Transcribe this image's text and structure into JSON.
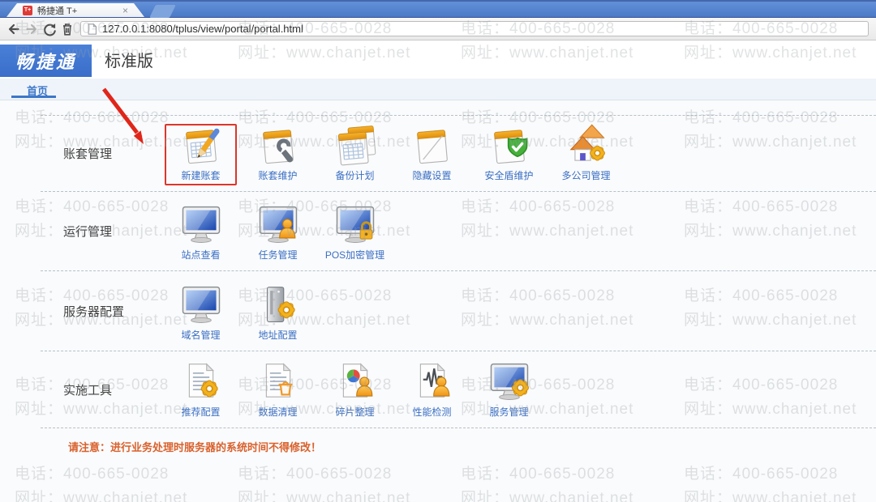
{
  "browser": {
    "tab": {
      "title": "畅捷通 T+",
      "favicon_text": "T+",
      "close_glyph": "×"
    },
    "url": "127.0.0.1:8080/tplus/view/portal/portal.html"
  },
  "header": {
    "logo": "畅捷通",
    "edition": "标准版"
  },
  "nav": {
    "home_tab": "首页"
  },
  "watermark": {
    "line1": "电话：400-665-0028",
    "line2": "网址：www.chanjet.net"
  },
  "content": {
    "sections": [
      {
        "label": "账套管理",
        "items": [
          {
            "label": "新建账套",
            "icon": "notepad-pencil-icon",
            "highlighted": true
          },
          {
            "label": "账套维护",
            "icon": "notepad-wrench-icon"
          },
          {
            "label": "备份计划",
            "icon": "notepad-stack-icon"
          },
          {
            "label": "隐藏设置",
            "icon": "notepad-blank-icon"
          },
          {
            "label": "安全盾维护",
            "icon": "notepad-shield-icon"
          },
          {
            "label": "多公司管理",
            "icon": "houses-gear-icon"
          }
        ]
      },
      {
        "label": "运行管理",
        "items": [
          {
            "label": "站点查看",
            "icon": "monitor-icon"
          },
          {
            "label": "任务管理",
            "icon": "monitor-person-icon"
          },
          {
            "label": "POS加密管理",
            "icon": "monitor-lock-icon"
          }
        ]
      },
      {
        "label": "服务器配置",
        "items": [
          {
            "label": "域名管理",
            "icon": "monitor-icon"
          },
          {
            "label": "地址配置",
            "icon": "server-gear-icon"
          }
        ]
      },
      {
        "label": "实施工具",
        "items": [
          {
            "label": "推荐配置",
            "icon": "document-gear-icon"
          },
          {
            "label": "数据清理",
            "icon": "document-bin-icon"
          },
          {
            "label": "碎片整理",
            "icon": "document-pie-person-icon"
          },
          {
            "label": "性能检测",
            "icon": "document-wave-person-icon"
          },
          {
            "label": "服务管理",
            "icon": "monitor-gear-icon"
          }
        ]
      }
    ],
    "notice": "请注意：进行业务处理时服务器的系统时间不得修改！"
  },
  "annotation": {
    "highlighted_item": "新建账套"
  },
  "colors": {
    "tab_strip_blue": "#5585d2",
    "logo_blue": "#3e74cf",
    "link_blue": "#3a6fc4",
    "notice_orange": "#d9612c",
    "highlight_red": "#dc362a",
    "watermark_gray": "#bdbdbd"
  }
}
